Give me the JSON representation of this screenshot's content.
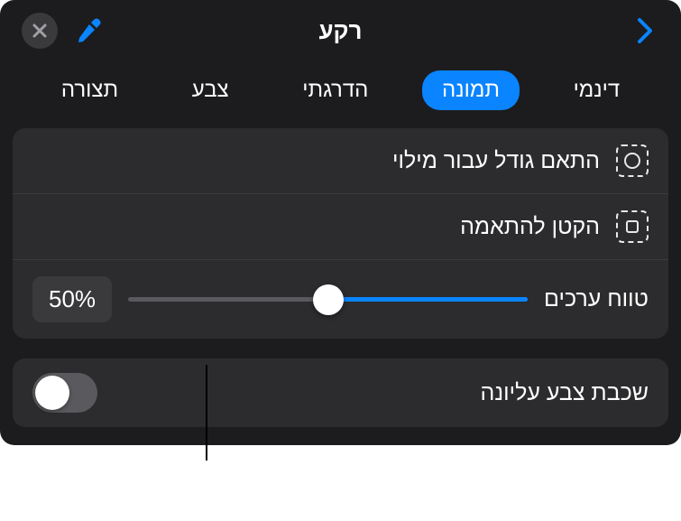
{
  "header": {
    "title": "רקע"
  },
  "tabs": {
    "items": [
      {
        "label": "תצורה"
      },
      {
        "label": "צבע"
      },
      {
        "label": "הדרגתי"
      },
      {
        "label": "תמונה"
      },
      {
        "label": "דינמי"
      }
    ],
    "active_index": 3
  },
  "options": {
    "scale_to_fill": "התאם גודל עבור מילוי",
    "scale_to_fit": "הקטן להתאמה",
    "scale_label": "טווח ערכים",
    "scale_value": "50%",
    "scale_percent": 50
  },
  "overlay": {
    "label": "שכבת צבע עליונה",
    "on": false
  }
}
